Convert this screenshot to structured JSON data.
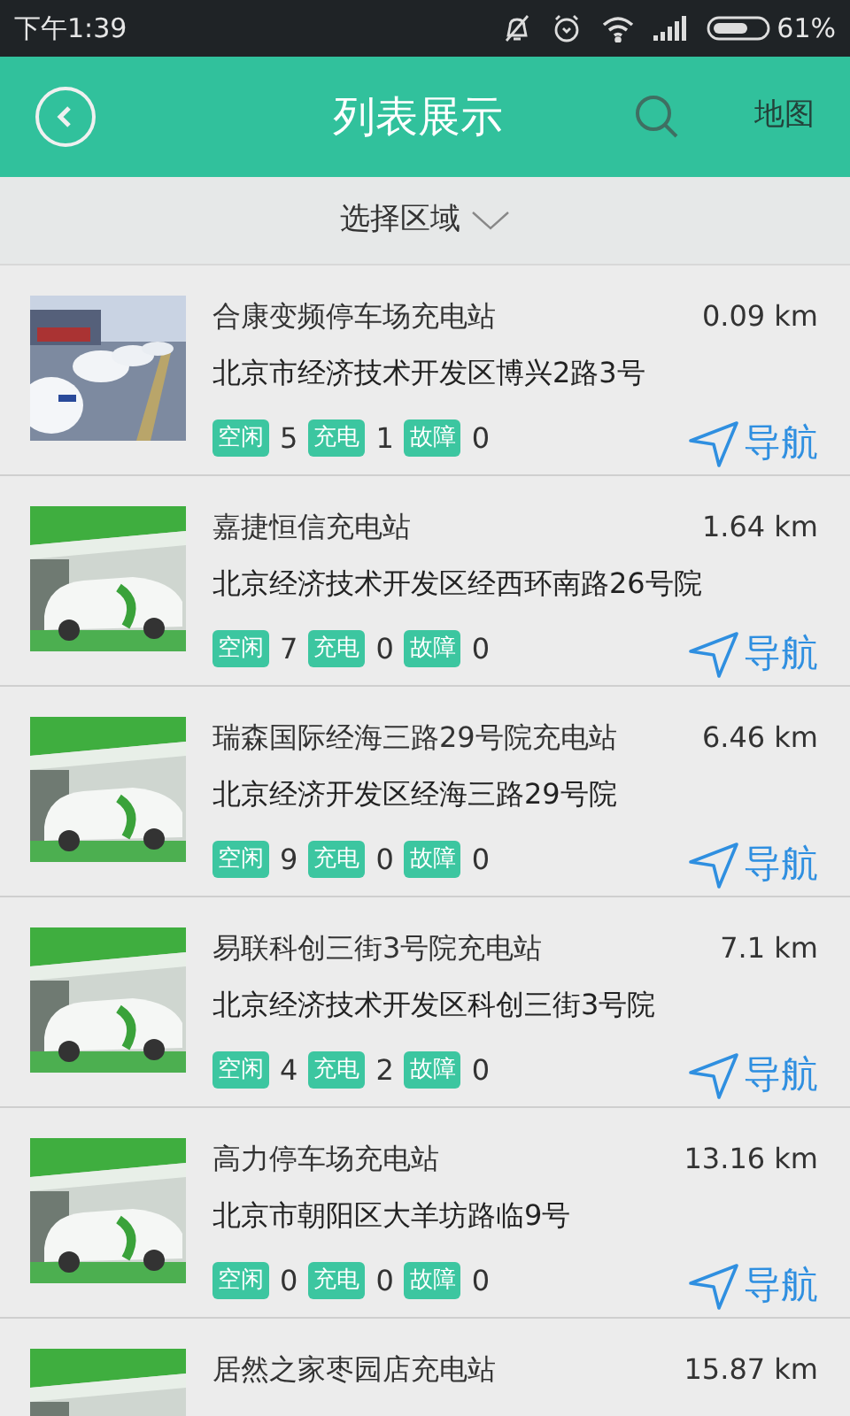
{
  "status_bar": {
    "time": "下午1:39",
    "battery": "61%"
  },
  "header": {
    "title": "列表展示",
    "map_link": "地图"
  },
  "filter": {
    "label": "选择区域"
  },
  "stations": [
    {
      "name": "合康变频停车场充电站",
      "distance": "0.09 km",
      "address": "北京市经济技术开发区博兴2路3号",
      "counts": [
        {
          "label": "空闲",
          "value": "5"
        },
        {
          "label": "充电",
          "value": "1"
        },
        {
          "label": "故障",
          "value": "0"
        }
      ],
      "nav": "导航"
    },
    {
      "name": "嘉捷恒信充电站",
      "distance": "1.64 km",
      "address": "北京经济技术开发区经西环南路26号院",
      "counts": [
        {
          "label": "空闲",
          "value": "7"
        },
        {
          "label": "充电",
          "value": "0"
        },
        {
          "label": "故障",
          "value": "0"
        }
      ],
      "nav": "导航"
    },
    {
      "name": "瑞森国际经海三路29号院充电站",
      "distance": "6.46 km",
      "address": "北京经济开发区经海三路29号院",
      "counts": [
        {
          "label": "空闲",
          "value": "9"
        },
        {
          "label": "充电",
          "value": "0"
        },
        {
          "label": "故障",
          "value": "0"
        }
      ],
      "nav": "导航"
    },
    {
      "name": "易联科创三街3号院充电站",
      "distance": "7.1 km",
      "address": "北京经济技术开发区科创三街3号院",
      "counts": [
        {
          "label": "空闲",
          "value": "4"
        },
        {
          "label": "充电",
          "value": "2"
        },
        {
          "label": "故障",
          "value": "0"
        }
      ],
      "nav": "导航"
    },
    {
      "name": "高力停车场充电站",
      "distance": "13.16 km",
      "address": "北京市朝阳区大羊坊路临9号",
      "counts": [
        {
          "label": "空闲",
          "value": "0"
        },
        {
          "label": "充电",
          "value": "0"
        },
        {
          "label": "故障",
          "value": "0"
        }
      ],
      "nav": "导航"
    },
    {
      "name": "居然之家枣园店充电站",
      "distance": "15.87 km"
    }
  ]
}
